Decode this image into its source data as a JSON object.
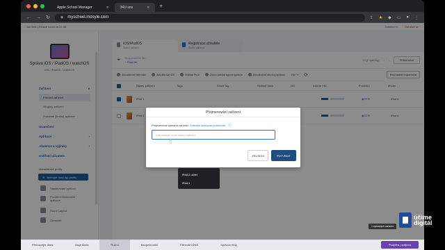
{
  "browser": {
    "tabs": [
      {
        "label": "Apple School Manager",
        "active": false
      },
      {
        "label": "34U sns",
        "active": true
      }
    ],
    "new_tab": "+",
    "url": "myschool.mosyle.com",
    "nav": {
      "back": "←",
      "forward": "→",
      "reload": "↻"
    }
  },
  "topstrip": {
    "left": "Jan Bek | Relace končí za 21:46",
    "help": "Nastavení",
    "logout": "Odhlásit se"
  },
  "sidebar": {
    "title": "Správa iOS / iPadOS / watchOS",
    "subtitle": "iOS / iPadOS / watchOS",
    "section_devices": "Zařízení",
    "items": [
      "Přehled zařízení",
      "Skupiny zařízení",
      "Podobné (limitní) aplikace"
    ],
    "sections": [
      "Uzamčení",
      "Aplikace",
      "Absence a výjimky",
      "Ověření uživatele"
    ],
    "profiles_header": "Manažerské profily",
    "profiles_button": "Aktivujte nový typ profilu",
    "profile_rows": [
      "Nastavování aplikací",
      "Povolené/blokované aplikace",
      "Home Layout",
      "Omezení"
    ]
  },
  "main": {
    "tabs": [
      {
        "label": "iOS/iPadOS",
        "sub": "Školní zařízení"
      },
      {
        "label": "Registrace uživatele",
        "sub": "Školní zařízení"
      }
    ],
    "filter_text": "Nový prvek/filtr filtr...",
    "filter_add": "+ Přidat filtr",
    "pager": "1/1 (2 výsledky)",
    "assign_button": "Přiřazování",
    "actions": [
      "Aktualizovat informace",
      "Aktualizovat iOS",
      "Odeslat Push",
      "Znovu odeslat agenta správce",
      "Aktualizovat všechny aplikace",
      "Více"
    ],
    "bulk_button": "Hromadně importovat",
    "columns": [
      "Název zařízení",
      "Tags",
      "Asset Tag",
      "Sériové číslo",
      "OS",
      "baterie",
      "HD",
      "Poslední",
      "Model"
    ],
    "rows": [
      {
        "name": "iPad 1",
        "model": "iPad 6"
      },
      {
        "name": "iPad 2",
        "model": "iPad 6"
      }
    ]
  },
  "modal": {
    "title": "Přejmenování zařízení",
    "label": "Přejmenovat vybraná zařízení",
    "label_link": "Zobrazit dostupné proměnné",
    "info": "ⓘ",
    "placeholder": "Zde zadejte nové název zařízení",
    "cancel": "ZRUŠENÍ",
    "confirm": "POTVRDIT",
    "suggestions": [
      "iPad 2 učitel",
      "iPad 1"
    ]
  },
  "bottombar": {
    "items": [
      "Přehrávejte dnes",
      "Moje škola",
      "Řízení",
      "Bezpečnostní",
      "Filtrování DNS",
      "Správce třídy"
    ],
    "active_index": 2,
    "submit": "Podpěra, podpora",
    "tooltip": "1 vybraných zařízení"
  },
  "watermark": {
    "line1": "účime",
    "line2": "digitál"
  },
  "colors": {
    "accent": "#1f4d82",
    "link": "#2f6fd1",
    "brand_purple": "#6a3fb0"
  }
}
